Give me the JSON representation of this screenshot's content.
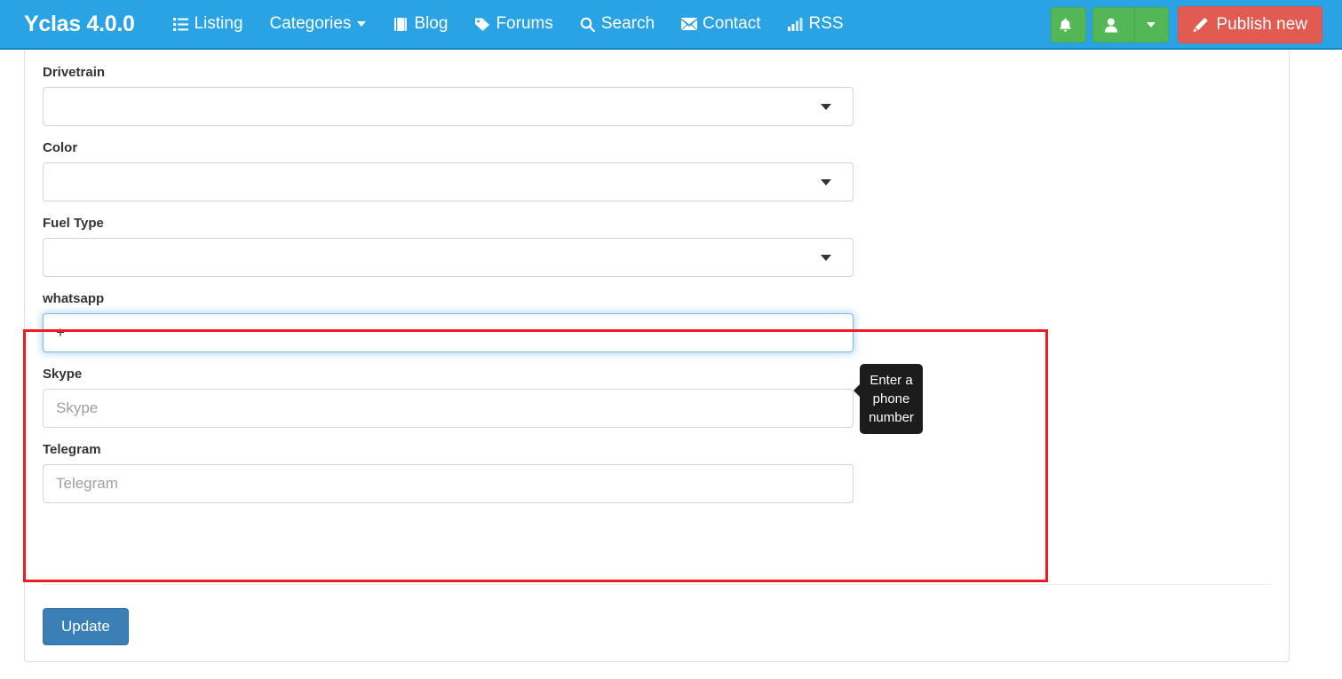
{
  "navbar": {
    "brand": "Yclas 4.0.0",
    "links": [
      {
        "label": "Listing",
        "icon": "list-icon",
        "caret": false
      },
      {
        "label": "Categories",
        "icon": "none",
        "caret": true
      },
      {
        "label": "Blog",
        "icon": "book-icon",
        "caret": false
      },
      {
        "label": "Forums",
        "icon": "tag-icon",
        "caret": false
      },
      {
        "label": "Search",
        "icon": "search-icon",
        "caret": false
      },
      {
        "label": "Contact",
        "icon": "envelope-icon",
        "caret": false
      },
      {
        "label": "RSS",
        "icon": "signal-icon",
        "caret": false
      }
    ],
    "notifications_icon": "bell-icon",
    "user_icon": "user-icon",
    "user_caret_icon": "chevron-down-icon",
    "publish_label": "Publish new",
    "publish_icon": "pencil-icon",
    "colors": {
      "navbar_bg": "#29a3e3",
      "green_button": "#53b755",
      "red_button": "#e15b53"
    }
  },
  "form": {
    "fields": [
      {
        "label": "Drivetrain",
        "type": "select",
        "value": "",
        "placeholder": ""
      },
      {
        "label": "Color",
        "type": "select",
        "value": "",
        "placeholder": ""
      },
      {
        "label": "Fuel Type",
        "type": "select",
        "value": "",
        "placeholder": ""
      },
      {
        "label": "whatsapp",
        "type": "text",
        "value": "+",
        "placeholder": ""
      },
      {
        "label": "Skype",
        "type": "text",
        "value": "",
        "placeholder": "Skype"
      },
      {
        "label": "Telegram",
        "type": "text",
        "value": "",
        "placeholder": "Telegram"
      }
    ],
    "submit_label": "Update"
  },
  "tooltip": {
    "text": "Enter a phone number"
  },
  "annotation": {
    "color": "#ec1c24"
  }
}
